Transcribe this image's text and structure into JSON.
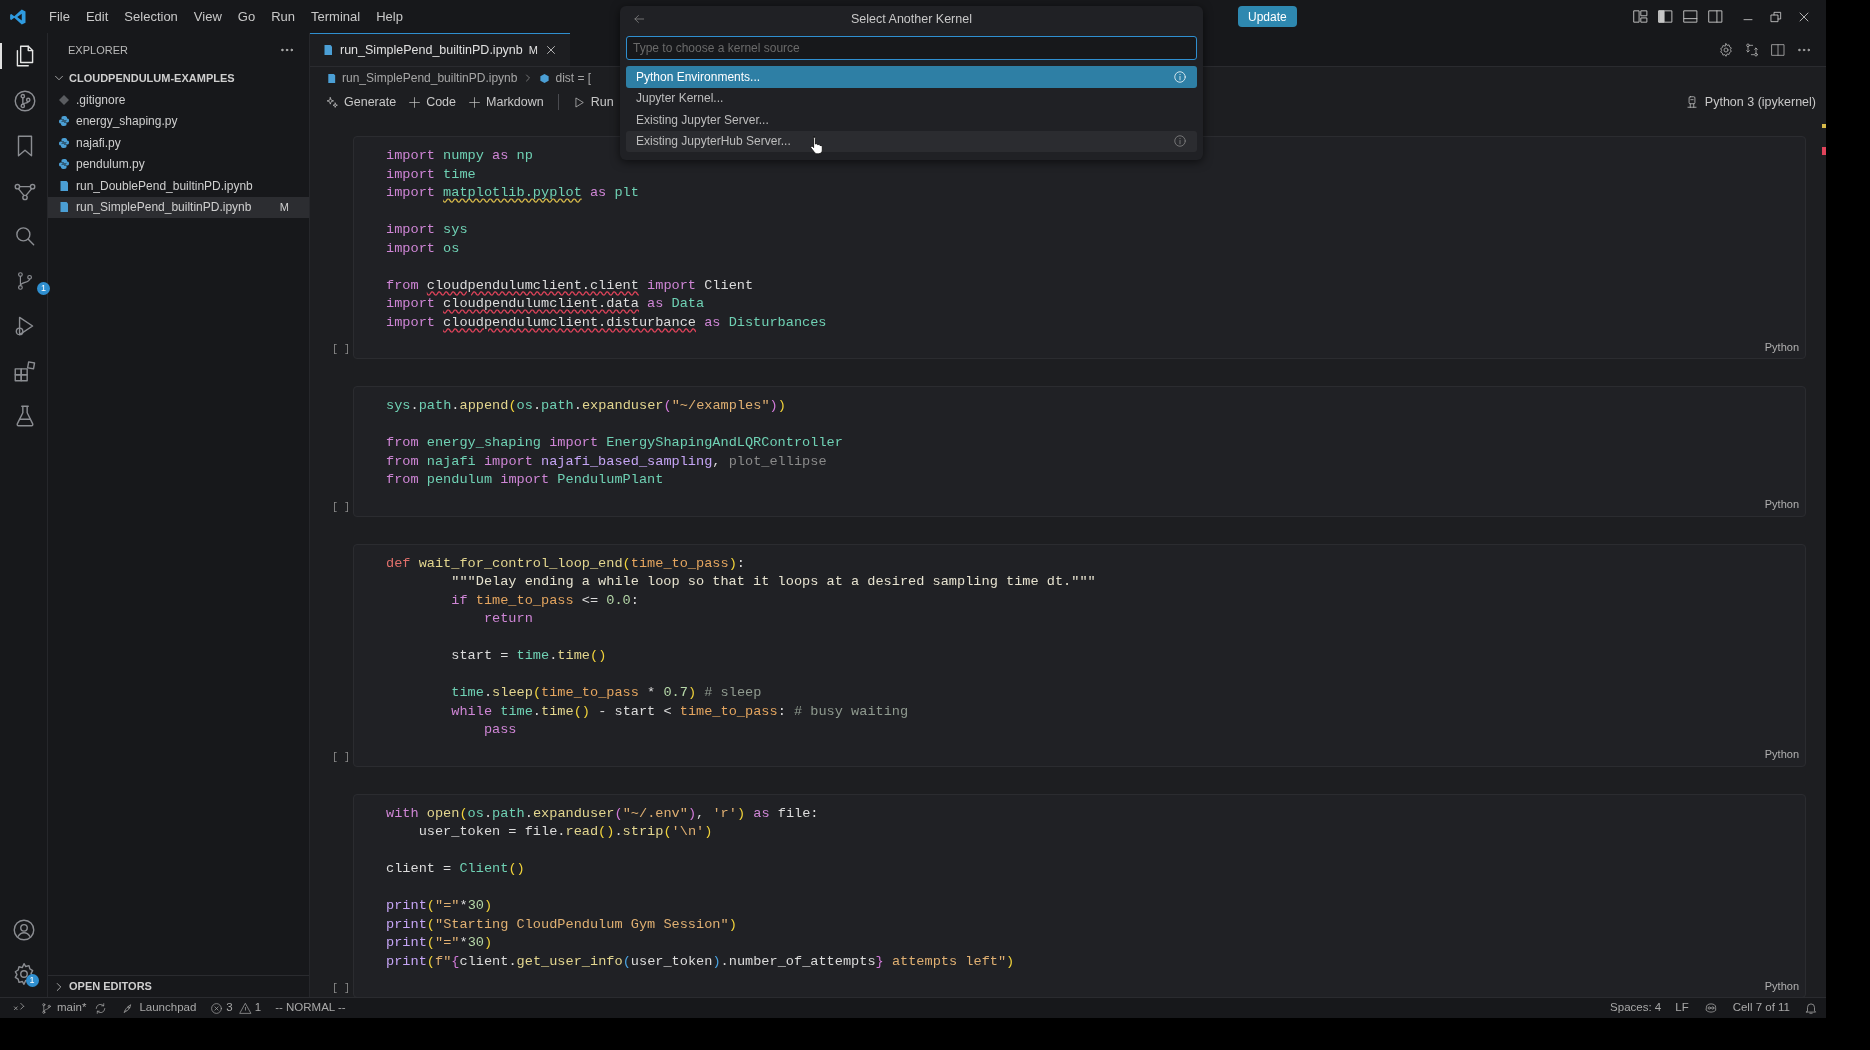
{
  "menu": [
    "File",
    "Edit",
    "Selection",
    "View",
    "Go",
    "Run",
    "Terminal",
    "Help"
  ],
  "update_button": "Update",
  "activity_bar": {
    "top": [
      {
        "kind": "files",
        "selected": true
      },
      {
        "kind": "branch-circle",
        "selected": false
      },
      {
        "kind": "bookmark",
        "selected": false
      },
      {
        "kind": "nodes",
        "selected": false
      },
      {
        "kind": "search",
        "selected": false
      },
      {
        "kind": "source-control",
        "selected": false,
        "badge": "1"
      },
      {
        "kind": "run-debug",
        "selected": false
      },
      {
        "kind": "extensions",
        "selected": false
      },
      {
        "kind": "flask",
        "selected": false
      }
    ],
    "bottom": [
      {
        "kind": "account"
      },
      {
        "kind": "settings",
        "badge": "1"
      }
    ]
  },
  "explorer": {
    "title": "EXPLORER",
    "folder": {
      "name": "CLOUDPENDULUM-EXAMPLES",
      "expanded": true,
      "children": [
        {
          "name": ".gitignore",
          "kind": "git",
          "selected": false
        },
        {
          "name": "energy_shaping.py",
          "kind": "python",
          "selected": false
        },
        {
          "name": "najafi.py",
          "kind": "python",
          "selected": false
        },
        {
          "name": "pendulum.py",
          "kind": "python",
          "selected": false
        },
        {
          "name": "run_DoublePend_builtinPD.ipynb",
          "kind": "notebook",
          "selected": false
        },
        {
          "name": "run_SimplePend_builtinPD.ipynb",
          "kind": "notebook",
          "selected": true,
          "badge": "M"
        }
      ]
    },
    "open_editors": {
      "name": "OPEN EDITORS",
      "expanded": false
    }
  },
  "tab": {
    "label": "run_SimplePend_builtinPD.ipynb",
    "badge": "M"
  },
  "breadcrumb": [
    {
      "kind": "notebook",
      "text": "run_SimplePend_builtinPD.ipynb"
    },
    {
      "kind": "symbol",
      "text": "dist = ["
    }
  ],
  "toolbar": [
    {
      "kind": "sparkle",
      "label": "Generate"
    },
    {
      "kind": "plus",
      "label": "Code"
    },
    {
      "kind": "plus",
      "label": "Markdown"
    },
    {
      "kind": "run",
      "label": "Run"
    }
  ],
  "kernel": "Python 3 (ipykernel)",
  "quick_pick": {
    "title": "Select Another Kernel",
    "placeholder": "Type to choose a kernel source",
    "items": [
      {
        "label": "Python Environments...",
        "selected": true,
        "hovered": false,
        "info": true
      },
      {
        "label": "Jupyter Kernel...",
        "selected": false,
        "hovered": false,
        "info": false
      },
      {
        "label": "Existing Jupyter Server...",
        "selected": false,
        "hovered": false,
        "info": false
      },
      {
        "label": "Existing JupyterHub Server...",
        "selected": false,
        "hovered": true,
        "info": true
      }
    ]
  },
  "cells": [
    {
      "execution": "[ ]",
      "language": "Python",
      "blocks": [
        [
          [
            {
              "kind": "kw",
              "text": "import "
            },
            {
              "kind": "mod",
              "text": "numpy"
            },
            {
              "kind": "kw",
              "text": " as "
            },
            {
              "kind": "mod",
              "text": "np"
            }
          ],
          [
            {
              "kind": "kw",
              "text": "import "
            },
            {
              "kind": "mod",
              "text": "time"
            }
          ],
          [
            {
              "kind": "kw",
              "text": "import "
            },
            {
              "kind": "warn",
              "text": "matplotlib.pyplot"
            },
            {
              "kind": "kw",
              "text": " as "
            },
            {
              "kind": "mod",
              "text": "plt"
            }
          ]
        ],
        [
          [
            {
              "kind": "kw",
              "text": "import "
            },
            {
              "kind": "mod",
              "text": "sys"
            }
          ],
          [
            {
              "kind": "kw",
              "text": "import "
            },
            {
              "kind": "mod",
              "text": "os"
            }
          ]
        ],
        [
          [
            {
              "kind": "kw",
              "text": "from "
            },
            {
              "kind": "err",
              "text": "cloudpendulumclient.client"
            },
            {
              "kind": "kw",
              "text": " import "
            },
            {
              "kind": "pl",
              "text": "Client"
            }
          ],
          [
            {
              "kind": "kw",
              "text": "import "
            },
            {
              "kind": "err",
              "text": "cloudpendulumclient.data"
            },
            {
              "kind": "kw",
              "text": " as "
            },
            {
              "kind": "mod",
              "text": "Data"
            }
          ],
          [
            {
              "kind": "kw",
              "text": "import "
            },
            {
              "kind": "err",
              "text": "cloudpendulumclient.disturbance"
            },
            {
              "kind": "kw",
              "text": " as "
            },
            {
              "kind": "mod",
              "text": "Disturbances"
            }
          ]
        ]
      ]
    },
    {
      "execution": "[ ]",
      "language": "Python",
      "blocks": [
        [
          [
            {
              "kind": "mod",
              "text": "sys"
            },
            {
              "kind": "pl",
              "text": "."
            },
            {
              "kind": "mod",
              "text": "path"
            },
            {
              "kind": "pl",
              "text": "."
            },
            {
              "kind": "fn",
              "text": "append"
            },
            {
              "kind": "br",
              "text": "("
            },
            {
              "kind": "mod",
              "text": "os"
            },
            {
              "kind": "pl",
              "text": "."
            },
            {
              "kind": "mod",
              "text": "path"
            },
            {
              "kind": "pl",
              "text": "."
            },
            {
              "kind": "fn",
              "text": "expanduser"
            },
            {
              "kind": "br2",
              "text": "("
            },
            {
              "kind": "str",
              "text": "\"~/examples\""
            },
            {
              "kind": "br2",
              "text": ")"
            },
            {
              "kind": "br",
              "text": ")"
            }
          ]
        ],
        [
          [
            {
              "kind": "kw",
              "text": "from "
            },
            {
              "kind": "mod",
              "text": "energy_shaping"
            },
            {
              "kind": "kw",
              "text": " import "
            },
            {
              "kind": "mod",
              "text": "EnergyShapingAndLQRController"
            }
          ],
          [
            {
              "kind": "kw",
              "text": "from "
            },
            {
              "kind": "mod",
              "text": "najafi"
            },
            {
              "kind": "kw",
              "text": " import "
            },
            {
              "kind": "fnu",
              "text": "najafi_based_sampling"
            },
            {
              "kind": "pl",
              "text": ", "
            },
            {
              "kind": "dim",
              "text": "plot_ellipse"
            }
          ],
          [
            {
              "kind": "kw",
              "text": "from "
            },
            {
              "kind": "mod",
              "text": "pendulum"
            },
            {
              "kind": "kw",
              "text": " import "
            },
            {
              "kind": "mod",
              "text": "PendulumPlant"
            }
          ]
        ]
      ]
    },
    {
      "execution": "[ ]",
      "language": "Python",
      "blocks": [
        [
          [
            {
              "kind": "def",
              "text": "def "
            },
            {
              "kind": "fn",
              "text": "wait_for_control_loop_end"
            },
            {
              "kind": "br",
              "text": "("
            },
            {
              "kind": "param",
              "text": "time_to_pass"
            },
            {
              "kind": "br",
              "text": ")"
            },
            {
              "kind": "pl",
              "text": ":"
            }
          ],
          [
            {
              "kind": "doc",
              "text": "        \"\"\"Delay ending a while loop so that it loops at a desired sampling time dt.\"\"\""
            }
          ],
          [
            {
              "kind": "kw",
              "text": "        if "
            },
            {
              "kind": "param",
              "text": "time_to_pass"
            },
            {
              "kind": "pl",
              "text": " <= "
            },
            {
              "kind": "num",
              "text": "0.0"
            },
            {
              "kind": "pl",
              "text": ":"
            }
          ],
          [
            {
              "kind": "kw",
              "text": "            return"
            }
          ]
        ],
        [
          [
            {
              "kind": "pl",
              "text": "        start = "
            },
            {
              "kind": "mod",
              "text": "time"
            },
            {
              "kind": "pl",
              "text": "."
            },
            {
              "kind": "fn",
              "text": "time"
            },
            {
              "kind": "br",
              "text": "()"
            }
          ]
        ],
        [
          [
            {
              "kind": "mod",
              "text": "        time"
            },
            {
              "kind": "pl",
              "text": "."
            },
            {
              "kind": "fn",
              "text": "sleep"
            },
            {
              "kind": "br",
              "text": "("
            },
            {
              "kind": "param",
              "text": "time_to_pass"
            },
            {
              "kind": "pl",
              "text": " * "
            },
            {
              "kind": "num",
              "text": "0.7"
            },
            {
              "kind": "br",
              "text": ")"
            },
            {
              "kind": "cm",
              "text": " # sleep"
            }
          ],
          [
            {
              "kind": "kw",
              "text": "        while "
            },
            {
              "kind": "mod",
              "text": "time"
            },
            {
              "kind": "pl",
              "text": "."
            },
            {
              "kind": "fn",
              "text": "time"
            },
            {
              "kind": "br",
              "text": "()"
            },
            {
              "kind": "pl",
              "text": " - start < "
            },
            {
              "kind": "param",
              "text": "time_to_pass"
            },
            {
              "kind": "pl",
              "text": ": "
            },
            {
              "kind": "cm",
              "text": "# busy waiting"
            }
          ],
          [
            {
              "kind": "kw",
              "text": "            pass"
            }
          ]
        ]
      ]
    },
    {
      "execution": "[ ]",
      "language": "Python",
      "blocks": [
        [
          [
            {
              "kind": "kw",
              "text": "with "
            },
            {
              "kind": "fn",
              "text": "open"
            },
            {
              "kind": "br",
              "text": "("
            },
            {
              "kind": "mod",
              "text": "os"
            },
            {
              "kind": "pl",
              "text": "."
            },
            {
              "kind": "mod",
              "text": "path"
            },
            {
              "kind": "pl",
              "text": "."
            },
            {
              "kind": "fn",
              "text": "expanduser"
            },
            {
              "kind": "br2",
              "text": "("
            },
            {
              "kind": "str",
              "text": "\"~/.env\""
            },
            {
              "kind": "br2",
              "text": ")"
            },
            {
              "kind": "pl",
              "text": ", "
            },
            {
              "kind": "str",
              "text": "'r'"
            },
            {
              "kind": "br",
              "text": ")"
            },
            {
              "kind": "kw",
              "text": " as "
            },
            {
              "kind": "pl",
              "text": "file:"
            }
          ],
          [
            {
              "kind": "pl",
              "text": "    user_token = file."
            },
            {
              "kind": "fn",
              "text": "read"
            },
            {
              "kind": "br",
              "text": "()"
            },
            {
              "kind": "pl",
              "text": "."
            },
            {
              "kind": "fn",
              "text": "strip"
            },
            {
              "kind": "br",
              "text": "("
            },
            {
              "kind": "str",
              "text": "'\\n'"
            },
            {
              "kind": "br",
              "text": ")"
            }
          ]
        ],
        [
          [
            {
              "kind": "pl",
              "text": "client = "
            },
            {
              "kind": "mod",
              "text": "Client"
            },
            {
              "kind": "br",
              "text": "()"
            }
          ]
        ],
        [
          [
            {
              "kind": "fnu",
              "text": "print"
            },
            {
              "kind": "br",
              "text": "("
            },
            {
              "kind": "str",
              "text": "\"=\""
            },
            {
              "kind": "pl",
              "text": "*"
            },
            {
              "kind": "num",
              "text": "30"
            },
            {
              "kind": "br",
              "text": ")"
            }
          ],
          [
            {
              "kind": "fnu",
              "text": "print"
            },
            {
              "kind": "br",
              "text": "("
            },
            {
              "kind": "str",
              "text": "\"Starting CloudPendulum Gym Session\""
            },
            {
              "kind": "br",
              "text": ")"
            }
          ],
          [
            {
              "kind": "fnu",
              "text": "print"
            },
            {
              "kind": "br",
              "text": "("
            },
            {
              "kind": "str",
              "text": "\"=\""
            },
            {
              "kind": "pl",
              "text": "*"
            },
            {
              "kind": "num",
              "text": "30"
            },
            {
              "kind": "br",
              "text": ")"
            }
          ],
          [
            {
              "kind": "fnu",
              "text": "print"
            },
            {
              "kind": "br",
              "text": "("
            },
            {
              "kind": "str",
              "text": "f\""
            },
            {
              "kind": "br2",
              "text": "{"
            },
            {
              "kind": "pl",
              "text": "client."
            },
            {
              "kind": "fn",
              "text": "get_user_info"
            },
            {
              "kind": "br3",
              "text": "("
            },
            {
              "kind": "pl",
              "text": "user_token"
            },
            {
              "kind": "br3",
              "text": ")"
            },
            {
              "kind": "pl",
              "text": ".number_of_attempts"
            },
            {
              "kind": "br2",
              "text": "}"
            },
            {
              "kind": "str",
              "text": " attempts left\""
            },
            {
              "kind": "br",
              "text": ")"
            }
          ]
        ]
      ]
    }
  ],
  "overview_marks": [
    {
      "color": "#d7ba4a"
    },
    {
      "color": "#e0435a"
    }
  ],
  "status_bar": {
    "branch": "main*",
    "launchpad": "Launchpad",
    "errors": "3",
    "warnings": "1",
    "mode": "-- NORMAL --",
    "spaces": "Spaces: 4",
    "eol": "LF",
    "cell": "Cell 7 of 11"
  }
}
